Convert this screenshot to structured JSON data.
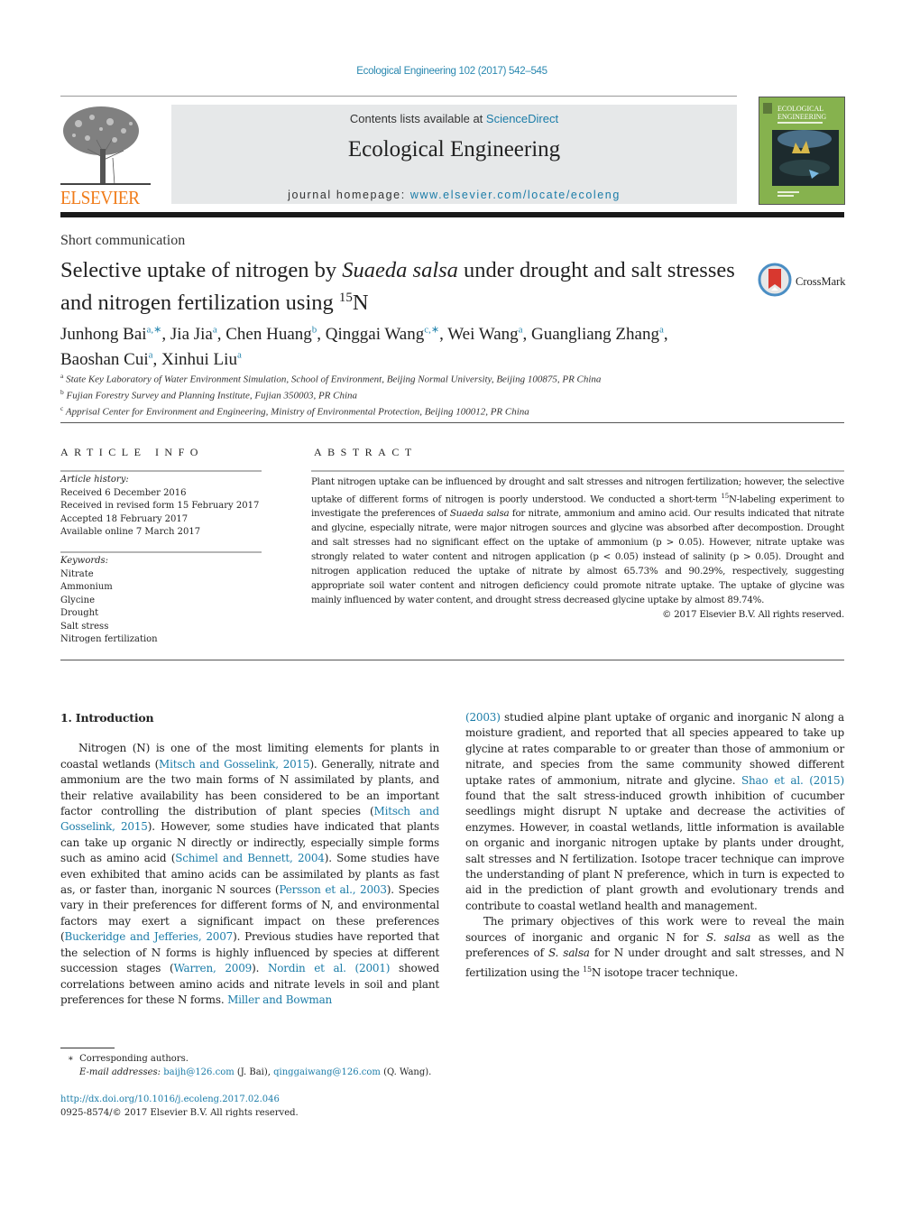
{
  "header": {
    "citation": "Ecological Engineering 102 (2017) 542–545",
    "contents_prefix": "Contents lists available at ",
    "contents_link": "ScienceDirect",
    "journal_name": "Ecological Engineering",
    "homepage_prefix": "journal homepage: ",
    "homepage_link": "www.elsevier.com/locate/ecoleng",
    "publisher_logo": "ELSEVIER",
    "cover_title_line1": "ECOLOGICAL",
    "cover_title_line2": "ENGINEERING",
    "colors": {
      "link": "#1b7ca8",
      "elsevier_orange": "#f07c1a",
      "masthead_bg": "#e6e8e9"
    }
  },
  "article": {
    "type": "Short communication",
    "title_part1": "Selective uptake of nitrogen by ",
    "title_italic": "Suaeda salsa",
    "title_part2": " under drought and salt stresses and nitrogen fertilization using ",
    "title_sup": "15",
    "title_end": "N",
    "crossmark_label": "CrossMark",
    "authors": [
      {
        "name": "Junhong Bai",
        "aff": "a,∗",
        "sep": ", "
      },
      {
        "name": "Jia Jia",
        "aff": "a",
        "sep": ", "
      },
      {
        "name": "Chen Huang",
        "aff": "b",
        "sep": ", "
      },
      {
        "name": "Qinggai Wang",
        "aff": "c,∗",
        "sep": ", "
      },
      {
        "name": "Wei Wang",
        "aff": "a",
        "sep": ", "
      },
      {
        "name": "Guangliang Zhang",
        "aff": "a",
        "sep": ", "
      },
      {
        "name": "Baoshan Cui",
        "aff": "a",
        "sep": ", "
      },
      {
        "name": "Xinhui Liu",
        "aff": "a",
        "sep": ""
      }
    ],
    "affiliations": [
      {
        "key": "a",
        "text": "State Key Laboratory of Water Environment Simulation, School of Environment, Beijing Normal University, Beijing 100875, PR China"
      },
      {
        "key": "b",
        "text": "Fujian Forestry Survey and Planning Institute, Fujian 350003, PR China"
      },
      {
        "key": "c",
        "text": "Apprisal Center for Environment and Engineering, Ministry of Environmental Protection, Beijing 100012, PR China"
      }
    ]
  },
  "article_info": {
    "heading": "ARTICLE INFO",
    "history_label": "Article history:",
    "history": [
      "Received 6 December 2016",
      "Received in revised form 15 February 2017",
      "Accepted 18 February 2017",
      "Available online 7 March 2017"
    ],
    "keywords_label": "Keywords:",
    "keywords": [
      "Nitrate",
      "Ammonium",
      "Glycine",
      "Drought",
      "Salt stress",
      "Nitrogen fertilization"
    ]
  },
  "abstract": {
    "heading": "ABSTRACT",
    "p1": "Plant nitrogen uptake can be influenced by drought and salt stresses and nitrogen fertilization; however, the selective uptake of different forms of nitrogen is poorly understood. We conducted a short-term ",
    "sup": "15",
    "p2": "N-labeling experiment to investigate the preferences of ",
    "italic": "Suaeda salsa",
    "p3": " for nitrate, ammonium and amino acid. Our results indicated that nitrate and glycine, especially nitrate, were major nitrogen sources and glycine was absorbed after decompostion. Drought and salt stresses had no significant effect on the uptake of ammonium (p > 0.05). However, nitrate uptake was strongly related to water content and nitrogen application (p < 0.05) instead of salinity (p > 0.05). Drought and nitrogen application reduced the uptake of nitrate by almost 65.73% and 90.29%, respectively, suggesting appropriate soil water content and nitrogen deficiency could promote nitrate uptake. The uptake of glycine was mainly influenced by water content, and drought stress decreased glycine uptake by almost 89.74%.",
    "copyright": "© 2017 Elsevier B.V. All rights reserved."
  },
  "body": {
    "section_heading": "1.  Introduction",
    "left_col": [
      {
        "t": "Nitrogen (N) is one of the most limiting elements for plants in coastal wetlands ("
      },
      {
        "l": "Mitsch and Gosselink, 2015"
      },
      {
        "t": "). Generally, nitrate and ammonium are the two main forms of N assimilated by plants, and their relative availability has been considered to be an important factor controlling the distribution of plant species ("
      },
      {
        "l": "Mitsch and Gosselink, 2015"
      },
      {
        "t": "). However, some studies have indicated that plants can take up organic N directly or indirectly, especially simple forms such as amino acid ("
      },
      {
        "l": "Schimel and Bennett, 2004"
      },
      {
        "t": "). Some studies have even exhibited that amino acids can be assimilated by plants as fast as, or faster than, inorganic N sources ("
      },
      {
        "l": "Persson et al., 2003"
      },
      {
        "t": "). Species vary in their preferences for different forms of N, and environmental factors may exert a significant impact on these preferences ("
      },
      {
        "l": "Buckeridge and Jefferies, 2007"
      },
      {
        "t": "). Previous studies have reported that the selection of N forms is highly influenced by species at different succession stages ("
      },
      {
        "l": "Warren, 2009"
      },
      {
        "t": "). "
      },
      {
        "l": "Nordin et al. (2001)"
      },
      {
        "t": " showed correlations between amino acids and nitrate levels in soil and plant preferences for these N forms. "
      },
      {
        "l": "Miller and Bowman"
      }
    ],
    "right_col_p1": [
      {
        "l": "(2003)"
      },
      {
        "t": " studied alpine plant uptake of organic and inorganic N along a moisture gradient, and reported that all species appeared to take up glycine at rates comparable to or greater than those of ammonium or nitrate, and species from the same community showed different uptake rates of ammonium, nitrate and glycine. "
      },
      {
        "l": "Shao et al. (2015)"
      },
      {
        "t": " found that the salt stress-induced growth inhibition of cucumber seedlings might disrupt N uptake and decrease the activities of enzymes. However, in coastal wetlands, little information is available on organic and inorganic nitrogen uptake by plants under drought, salt stresses and N fertilization. Isotope tracer technique can improve the understanding of plant N preference, which in turn is expected to aid in the prediction of plant growth and evolutionary trends and contribute to coastal wetland health and management."
      }
    ],
    "right_col_p2": [
      {
        "t": "The primary objectives of this work were to reveal the main sources of inorganic and organic N for "
      },
      {
        "i": "S. salsa"
      },
      {
        "t": " as well as the preferences of "
      },
      {
        "i": "S. salsa"
      },
      {
        "t": " for N under drought and salt stresses, and N fertilization using the "
      },
      {
        "s": "15"
      },
      {
        "t": "N isotope tracer technique."
      }
    ]
  },
  "footnotes": {
    "star": "∗",
    "corresponding": "Corresponding authors.",
    "email_label": "E-mail addresses:",
    "email1": "baijh@126.com",
    "email1_who": " (J. Bai), ",
    "email2": "qinggaiwang@126.com",
    "email2_who": " (Q. Wang).",
    "doi": "http://dx.doi.org/10.1016/j.ecoleng.2017.02.046",
    "issn": "0925-8574/© 2017 Elsevier B.V. All rights reserved."
  }
}
